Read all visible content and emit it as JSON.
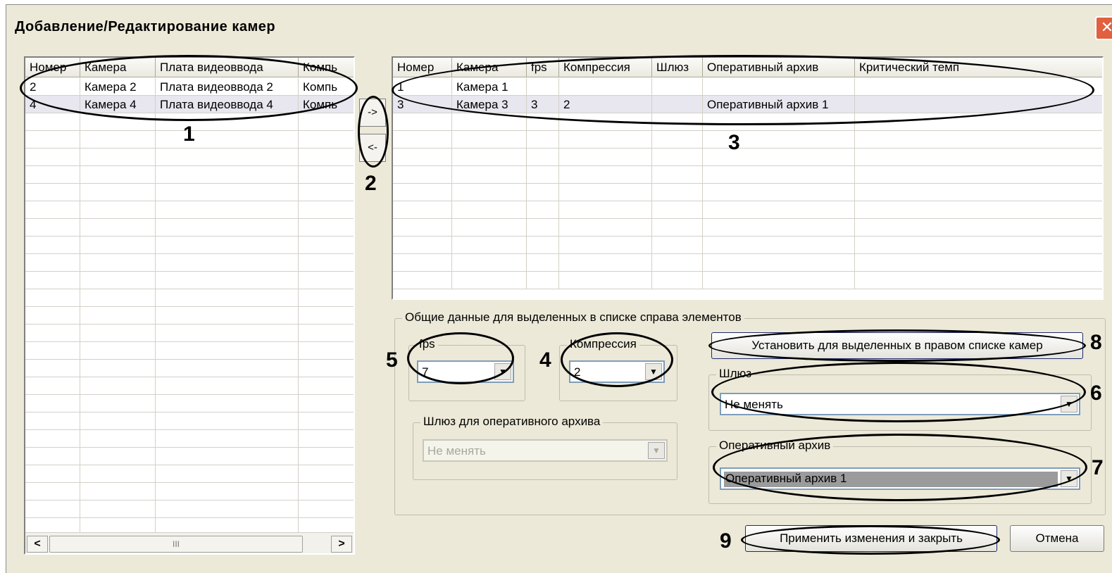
{
  "window": {
    "title": "Добавление/Редактирование камер",
    "close_symbol": "✕"
  },
  "left_list": {
    "columns": [
      "Номер",
      "Камера",
      "Плата видеоввода",
      "Компь"
    ],
    "rows": [
      [
        "2",
        "Камера 2",
        "Плата видеоввода 2",
        "Компь"
      ],
      [
        "4",
        "Камера 4",
        "Плата видеоввода 4",
        "Компь"
      ]
    ],
    "scroll_left": "<",
    "scroll_right": ">",
    "scroll_thumb": "III"
  },
  "move_buttons": {
    "add": "->",
    "remove": "<-"
  },
  "right_list": {
    "columns": [
      "Номер",
      "Камера",
      "fps",
      "Компрессия",
      "Шлюз",
      "Оперативный архив",
      "Критический темп"
    ],
    "rows": [
      [
        "1",
        "Камера 1",
        "",
        "",
        "",
        "",
        ""
      ],
      [
        "3",
        "Камера 3",
        "3",
        "2",
        "",
        "Оперативный архив 1",
        ""
      ]
    ]
  },
  "common_group": {
    "legend": "Общие данные для выделенных в списке справа элементов",
    "fps": {
      "label": "fps",
      "value": "7"
    },
    "compression": {
      "label": "Компрессия",
      "value": "2"
    },
    "oper_archive_gateway": {
      "label": "Шлюз для оперативного архива",
      "value": "Не менять"
    },
    "set_button": "Установить для выделенных в правом списке камер",
    "gateway": {
      "label": "Шлюз",
      "value": "Не менять"
    },
    "oper_archive": {
      "label": "Оперативный архив",
      "value": "Оперативный архив 1"
    }
  },
  "footer": {
    "apply_button": "Применить изменения и закрыть",
    "cancel_button": "Отмена"
  },
  "callouts": [
    "1",
    "2",
    "3",
    "4",
    "5",
    "6",
    "7",
    "8",
    "9"
  ],
  "icons": {
    "dropdown": "▼"
  }
}
